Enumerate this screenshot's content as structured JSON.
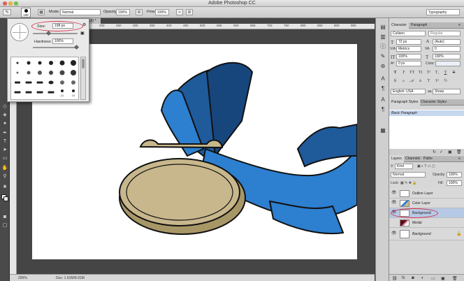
{
  "app": {
    "title": "Adobe Photoshop CC"
  },
  "options_bar": {
    "brush_size": "198",
    "mode_label": "Mode:",
    "mode_value": "Normal",
    "opacity_label": "Opacity:",
    "opacity_value": "100%",
    "flow_label": "Flow:",
    "flow_value": "100%",
    "workspace": "Typography"
  },
  "brush_popup": {
    "size_label": "Size:",
    "size_value": "198 px",
    "hardness_label": "Hardness:",
    "hardness_value": "100%",
    "preset_labels": [
      "21",
      "10"
    ]
  },
  "document": {
    "tab_label": "(8) *",
    "ruler_ticks": [
      "200",
      "250",
      "300",
      "350",
      "400",
      "450",
      "500",
      "550",
      "600",
      "650",
      "700",
      "750",
      "800",
      "850",
      "900",
      "950"
    ],
    "zoom": "200%",
    "doc_info": "Doc: 1.91M/8.91M"
  },
  "character_panel": {
    "tabs": [
      "Character",
      "Paragraph"
    ],
    "font_family": "Cuilano",
    "font_style": "Regular",
    "font_size": "72 px",
    "leading": "(Auto)",
    "kerning": "Metrics",
    "tracking": "0",
    "vertical_scale": "100%",
    "horizontal_scale": "100%",
    "baseline": "0 px",
    "color_label": "Color:",
    "type_buttons": [
      "T",
      "T",
      "TT",
      "Tt",
      "T¹",
      "T₁",
      "T",
      "T"
    ],
    "language": "English: USA",
    "antialias": "Sharp"
  },
  "styles_panel": {
    "tabs": [
      "Paragraph Styles",
      "Character Styles"
    ],
    "selected_style": "Basic Paragraph"
  },
  "layers_panel": {
    "tabs": [
      "Layers",
      "Channels",
      "Paths"
    ],
    "filter": "Kind",
    "blend_mode": "Normal",
    "opacity_label": "Opacity:",
    "opacity_value": "100%",
    "lock_label": "Lock:",
    "fill_label": "Fill:",
    "fill_value": "100%",
    "layers": [
      {
        "name": "Outline Layer",
        "visible": true,
        "selected": false
      },
      {
        "name": "Color Layer",
        "visible": true,
        "selected": false
      },
      {
        "name": "Background",
        "visible": true,
        "selected": true
      },
      {
        "name": "Medal",
        "visible": false,
        "selected": false
      },
      {
        "name": "Background",
        "visible": true,
        "selected": false,
        "locked": true
      }
    ]
  },
  "colors": {
    "ribbon": "#2d7fcf",
    "ribbon_dark": "#1c4f8a",
    "medal_face": "#c8b78c",
    "medal_rim": "#a89766",
    "highlight_red": "#d9334a",
    "selection_blue": "#b6c9e6"
  }
}
